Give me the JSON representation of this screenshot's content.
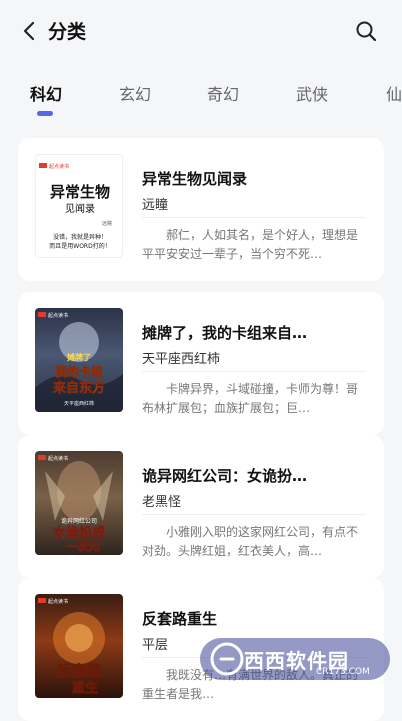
{
  "header": {
    "title": "分类"
  },
  "tabs": [
    {
      "label": "科幻",
      "active": true
    },
    {
      "label": "玄幻",
      "active": false
    },
    {
      "label": "奇幻",
      "active": false
    },
    {
      "label": "武侠",
      "active": false
    },
    {
      "label": "仙",
      "active": false
    }
  ],
  "books": [
    {
      "title": "异常生物见闻录",
      "author": "远瞳",
      "description": "郝仁，人如其名，是个好人，理想是平平安安过一辈子，当个穷不死…",
      "cover": {
        "badge": "起点读书",
        "title_line1": "异常生物",
        "title_line2": "见闻录",
        "author": "远瞳",
        "tagline_line1": "没错，我就是异种！",
        "tagline_line2": "而且是用WORD打的！"
      }
    },
    {
      "title": "摊牌了，我的卡组来自…",
      "author": "天平座西红柿",
      "description": "卡牌异界，斗域碰撞，卡师为尊！哥布林扩展包；血族扩展包；巨…",
      "cover": {
        "badge": "起点读书",
        "title_line1": "摊牌了",
        "title_line2": "我的卡组",
        "title_line3": "来自东方",
        "author": "天平座西红柿"
      }
    },
    {
      "title": "诡异网红公司：女诡扮…",
      "author": "老黑怪",
      "description": "小雅刚入职的这家网红公司，有点不对劲。头牌红姐，红衣美人，高…",
      "cover": {
        "badge": "起点读书",
        "title_line1": "诡异网红公司",
        "title_line2": "女诡扮成",
        "title_line3": "一次元"
      }
    },
    {
      "title": "反套路重生",
      "author": "平层",
      "description": "我既没有…有满世界的敌人。真正的重生者是我…",
      "cover": {
        "badge": "起点读书",
        "title_line1": "反套路",
        "title_line2": "重生"
      }
    }
  ],
  "watermark": {
    "text": "西西软件园",
    "url": "CR173.COM"
  }
}
